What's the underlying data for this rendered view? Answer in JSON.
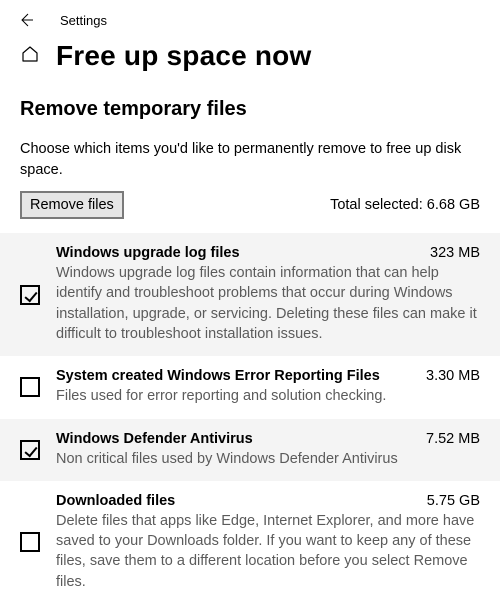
{
  "topbar": {
    "app_title": "Settings"
  },
  "header": {
    "page_title": "Free up space now"
  },
  "section": {
    "heading": "Remove temporary files",
    "description": "Choose which items you'd like to permanently remove to free up disk space.",
    "remove_button_label": "Remove files",
    "total_selected_label": "Total selected: 6.68 GB"
  },
  "items": [
    {
      "title": "Windows upgrade log files",
      "size": "323 MB",
      "description": "Windows upgrade log files contain information that can help identify and troubleshoot problems that occur during Windows installation, upgrade, or servicing.  Deleting these files can make it difficult to troubleshoot installation issues."
    },
    {
      "title": "System created Windows Error Reporting Files",
      "size": "3.30 MB",
      "description": "Files used for error reporting and solution checking."
    },
    {
      "title": "Windows Defender Antivirus",
      "size": "7.52 MB",
      "description": "Non critical files used by Windows Defender Antivirus"
    },
    {
      "title": "Downloaded files",
      "size": "5.75 GB",
      "description": "Delete files that apps like Edge, Internet Explorer, and more have saved to your Downloads folder. If you want to keep any of these files, save them to a different location before you select Remove files."
    }
  ]
}
